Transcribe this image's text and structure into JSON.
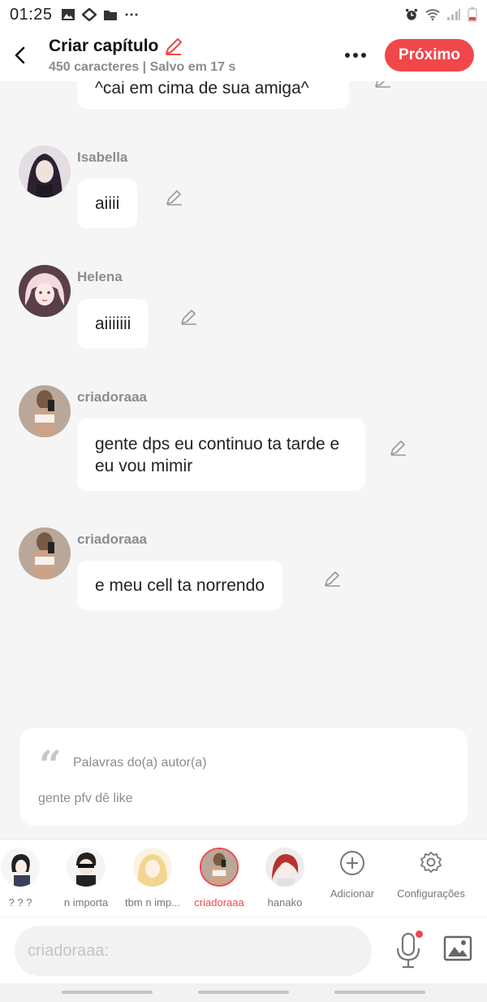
{
  "status_bar": {
    "time": "01:25"
  },
  "header": {
    "title": "Criar capítulo",
    "subtitle": "450 caracteres | Salvo em 17 s",
    "next_label": "Próximo"
  },
  "messages": [
    {
      "text": "^cai em cima de sua amiga^"
    },
    {
      "name": "Isabella",
      "text": "aiiii"
    },
    {
      "name": "Helena",
      "text": "aiiiiiii"
    },
    {
      "name": "criadoraaa",
      "text": "gente dps eu continuo ta tarde e eu vou mimir"
    },
    {
      "name": "criadoraaa",
      "text": "e meu cell ta norrendo"
    }
  ],
  "author_words": {
    "label": "Palavras do(a) autor(a)",
    "text": "gente pfv dê like"
  },
  "characters": [
    {
      "label": "? ? ?",
      "active": false
    },
    {
      "label": "n importa",
      "active": false
    },
    {
      "label": "tbm n imp...",
      "active": false
    },
    {
      "label": "criadoraaa",
      "active": true
    },
    {
      "label": "hanako",
      "active": false
    }
  ],
  "tools": {
    "add_label": "Adicionar",
    "settings_label": "Configurações"
  },
  "input": {
    "placeholder": "criadoraaa:"
  },
  "colors": {
    "accent": "#f0474b",
    "background": "#f5f5f5"
  }
}
